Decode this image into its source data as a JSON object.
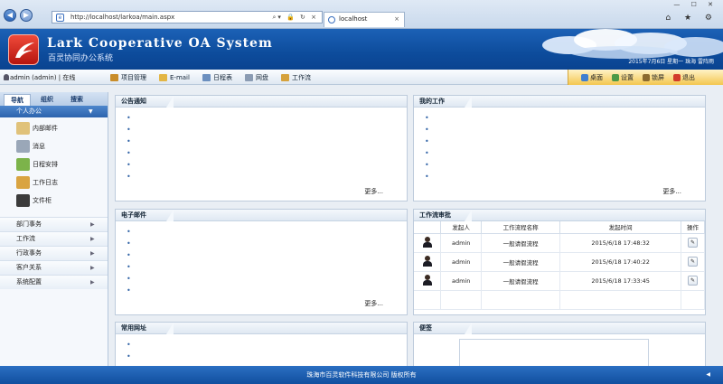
{
  "browser": {
    "address": "http://localhost/larkoa/main.aspx",
    "tab_title": "localhost",
    "tab_close": "×",
    "address_tools": "⌕▾ 🔒 ↻ ×",
    "right_icons": "⌂ ★ ⚙",
    "window_controls": "— ☐ ✕"
  },
  "app": {
    "title": "Lark Cooperative OA System",
    "subtitle": "百灵协同办公系统",
    "date_line": "2015年7月6日 星期一 珠海  雷阵雨"
  },
  "toolbar": {
    "user": "admin (admin)",
    "status": "在线",
    "menu": [
      {
        "label": "项目管理",
        "color": "#c98d2a"
      },
      {
        "label": "E-mail",
        "color": "#e3b645"
      },
      {
        "label": "日程表",
        "color": "#6b8fbf"
      },
      {
        "label": "网盘",
        "color": "#8b9cb3"
      },
      {
        "label": "工作流",
        "color": "#d6a23c"
      }
    ],
    "quick": [
      {
        "label": "桌面",
        "color": "#3f7fd0"
      },
      {
        "label": "设置",
        "color": "#4d9a47"
      },
      {
        "label": "锁屏",
        "color": "#8b6a2f"
      },
      {
        "label": "退出",
        "color": "#d23a2a"
      }
    ]
  },
  "sidebar": {
    "tabs": [
      "导航",
      "组织",
      "搜索"
    ],
    "open_group": "个人办公",
    "sub_items": [
      {
        "label": "内部邮件",
        "color": "#e0c27a"
      },
      {
        "label": "消息",
        "color": "#9aa7b8"
      },
      {
        "label": "日程安排",
        "color": "#7cb34a"
      },
      {
        "label": "工作日志",
        "color": "#d9a441"
      },
      {
        "label": "文件柜",
        "color": "#3b3b3b"
      }
    ],
    "groups": [
      "部门事务",
      "工作流",
      "行政事务",
      "客户关系",
      "系统配置"
    ]
  },
  "panels": {
    "notice": {
      "title": "公告通知",
      "more": "更多..."
    },
    "my_work": {
      "title": "我的工作",
      "more": "更多..."
    },
    "email": {
      "title": "电子邮件",
      "more": "更多..."
    },
    "workflow": {
      "title": "工作流审批",
      "headers": [
        "",
        "发起人",
        "工作流程名称",
        "发起时间",
        "操作"
      ],
      "rows": [
        {
          "initiator": "admin",
          "name": "一般请假流程",
          "time": "2015/6/18 17:48:32"
        },
        {
          "initiator": "admin",
          "name": "一般请假流程",
          "time": "2015/6/18 17:40:22"
        },
        {
          "initiator": "admin",
          "name": "一般请假流程",
          "time": "2015/6/18 17:33:45"
        }
      ]
    },
    "links": {
      "title": "常用网址"
    },
    "notes": {
      "title": "便签"
    }
  },
  "footer": {
    "text": "珠海市百灵软件科技有限公司 版权所有"
  }
}
